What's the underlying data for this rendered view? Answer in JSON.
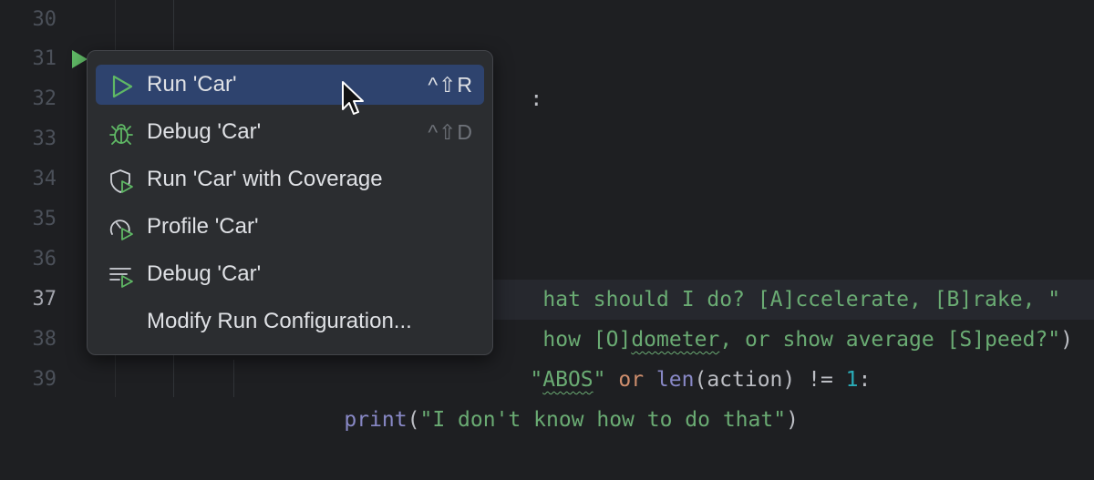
{
  "editor": {
    "line_numbers": [
      "30",
      "31",
      "32",
      "33",
      "34",
      "35",
      "36",
      "37",
      "38",
      "39"
    ],
    "current_line_index": 7,
    "code_fragments": {
      "line31_colon": ":",
      "line36_string": "hat should I do? [A]ccelerate, [B]rake, \"",
      "line37_str_a": "how [O]",
      "line37_str_b": "dometer",
      "line37_str_c": ", or show average [S]peed?\"",
      "line37_close": ")",
      "line38_str_a": "\"",
      "line38_str_b": "ABOS",
      "line38_str_c": "\"",
      "line38_kw": "or",
      "line38_fn": "len",
      "line38_arg": "(action) != ",
      "line38_num": "1",
      "line38_colon": ":",
      "line39_fn": "print",
      "line39_open": "(",
      "line39_str": "\"I don't know how to do that\"",
      "line39_close": ")"
    }
  },
  "menu": {
    "items": [
      {
        "label": "Run 'Car'",
        "shortcut": "^⇧R",
        "icon": "run-icon",
        "selected": true
      },
      {
        "label": "Debug 'Car'",
        "shortcut": "^⇧D",
        "icon": "debug-bug-icon",
        "selected": false
      },
      {
        "label": "Run 'Car' with Coverage",
        "shortcut": "",
        "icon": "coverage-shield-icon",
        "selected": false
      },
      {
        "label": "Profile 'Car'",
        "shortcut": "",
        "icon": "profiler-gauge-icon",
        "selected": false
      },
      {
        "label": "Debug 'Car'",
        "shortcut": "",
        "icon": "concurrency-diagram-icon",
        "selected": false
      },
      {
        "label": "Modify Run Configuration...",
        "shortcut": "",
        "icon": "",
        "selected": false
      }
    ]
  },
  "colors": {
    "background": "#1e1f22",
    "popup": "#2b2d30",
    "selection": "#2e436e",
    "run_green": "#5fb865",
    "string": "#6aab73",
    "keyword": "#cf8e6d"
  }
}
